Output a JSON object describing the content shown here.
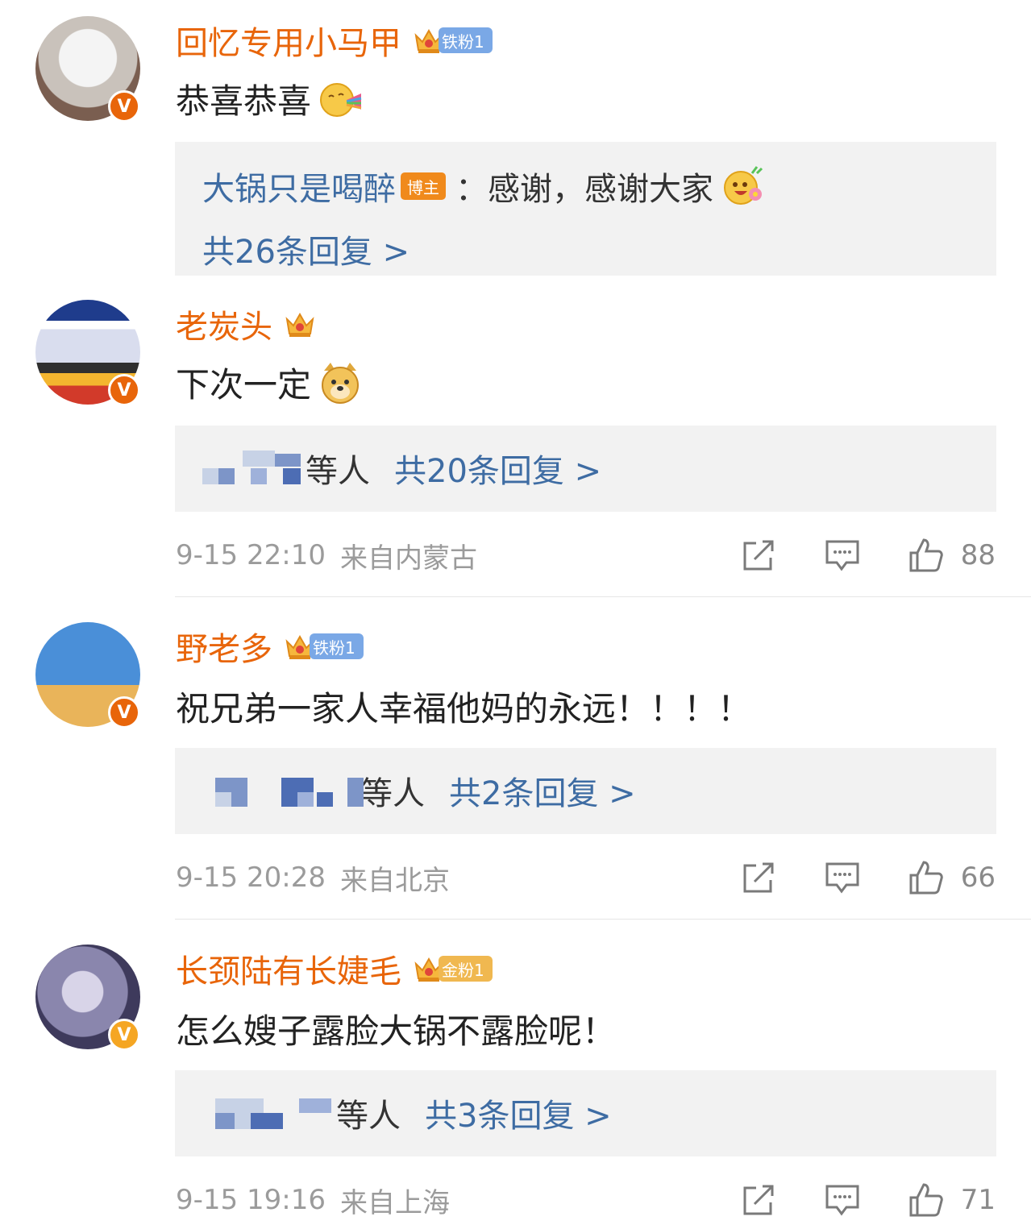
{
  "comments": [
    {
      "username": "回忆专用小马甲",
      "fan_badge": "铁粉1",
      "text": "恭喜恭喜",
      "reply_preview": {
        "author": "大锅只是喝醉",
        "author_badge": "博主",
        "text": "：感谢，感谢大家",
        "count_label": "共26条回复 >"
      }
    },
    {
      "username": "老炭头",
      "text": "下次一定",
      "reply_summary": {
        "others_label": "等人",
        "count_label": "共20条回复 >"
      },
      "timestamp": "9-15 22:10",
      "location": "来自内蒙古",
      "likes": "88"
    },
    {
      "username": "野老多",
      "fan_badge": "铁粉1",
      "text": "祝兄弟一家人幸福他妈的永远！！！！",
      "reply_summary": {
        "others_label": "等人",
        "count_label": "共2条回复 >"
      },
      "timestamp": "9-15 20:28",
      "location": "来自北京",
      "likes": "66"
    },
    {
      "username": "长颈陆有长婕毛",
      "fan_badge": "金粉1",
      "text": "怎么嫂子露脸大锅不露脸呢！",
      "reply_summary": {
        "others_label": "等人",
        "count_label": "共3条回复 >"
      },
      "timestamp": "9-15 19:16",
      "location": "来自上海",
      "likes": "71"
    }
  ],
  "verified_mark": "V",
  "icons": [
    "share-icon",
    "comment-icon",
    "like-icon",
    "crown-icon",
    "verified-badge-icon"
  ],
  "colors": {
    "username": "#e8650a",
    "link": "#3e6ca3",
    "meta": "#9b9b9b",
    "reply_bg": "#f2f2f2"
  }
}
